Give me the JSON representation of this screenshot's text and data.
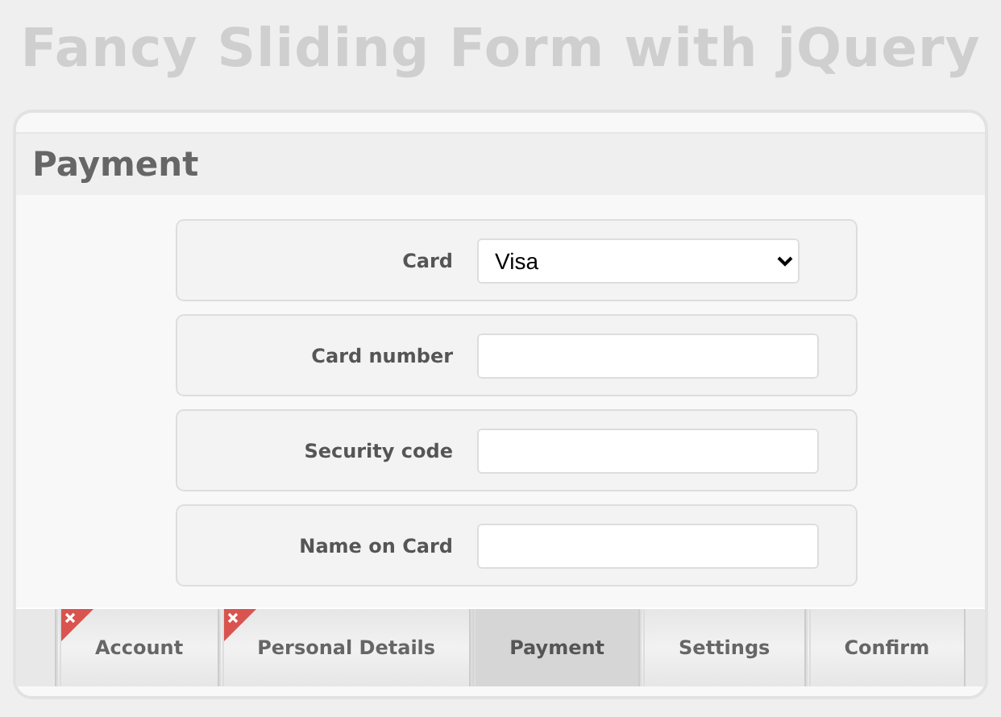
{
  "page_title": "Fancy Sliding Form with jQuery",
  "form": {
    "heading": "Payment",
    "fields": [
      {
        "kind": "select",
        "label": "Card",
        "value": "Visa"
      },
      {
        "kind": "text",
        "label": "Card number"
      },
      {
        "kind": "text",
        "label": "Security code"
      },
      {
        "kind": "text",
        "label": "Name on Card"
      }
    ]
  },
  "tabs": [
    {
      "label": "Account",
      "selected": false,
      "error": true
    },
    {
      "label": "Personal Details",
      "selected": false,
      "error": true
    },
    {
      "label": "Payment",
      "selected": true,
      "error": false
    },
    {
      "label": "Settings",
      "selected": false,
      "error": false
    },
    {
      "label": "Confirm",
      "selected": false,
      "error": false
    }
  ]
}
